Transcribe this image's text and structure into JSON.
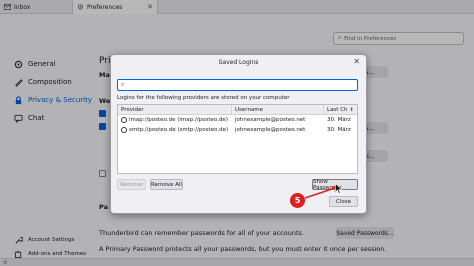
{
  "tabs": [
    {
      "label": "Inbox",
      "icon": "inbox-icon"
    },
    {
      "label": "Preferences",
      "icon": "gear-icon",
      "close": "✕"
    }
  ],
  "search": {
    "placeholder": "Find in Preferences"
  },
  "sidebar": {
    "items": [
      {
        "label": "General",
        "icon": "gear-icon"
      },
      {
        "label": "Composition",
        "icon": "pen-icon"
      },
      {
        "label": "Privacy & Security",
        "icon": "lock-icon",
        "active": true
      },
      {
        "label": "Chat",
        "icon": "chat-icon"
      }
    ],
    "bottom": [
      {
        "label": "Account Settings",
        "icon": "wrench-icon"
      },
      {
        "label": "Add-ons and Themes",
        "icon": "puzzle-icon"
      }
    ]
  },
  "background": {
    "heading": "Privacy",
    "frag_ma": "Ma",
    "frag_we": "We",
    "frag_pa": "Pa",
    "btn_exceptions_1": "ptions...",
    "btn_exceptions_2": "ptions...",
    "btn_cookies": "ookies...",
    "saved_text": "Thunderbird can remember passwords for all of your accounts.",
    "saved_button": "Saved Passwords...",
    "primary_text": "A Primary Password protects all your passwords, but you must enter it once per session."
  },
  "dialog": {
    "title": "Saved Logins",
    "close": "✕",
    "search_value": "",
    "info": "Logins for the following providers are stored on your computer",
    "columns": {
      "provider": "Provider",
      "username": "Username",
      "last": "Last Ch"
    },
    "rows": [
      {
        "provider": "imap://posteo.de (imap://posteo.de)",
        "username": "johnexample@posteo.net",
        "last": "30. März"
      },
      {
        "provider": "smtp://posteo.de (smtp://posteo.de)",
        "username": "johnexample@posteo.net",
        "last": "30. März"
      }
    ],
    "buttons": {
      "remove": "Remove",
      "remove_all": "Remove All",
      "show_passwords": "Show Passwords",
      "close": "Close"
    }
  },
  "step_badge": "5",
  "colors": {
    "accent": "#0061e0",
    "badge": "#e02020"
  }
}
